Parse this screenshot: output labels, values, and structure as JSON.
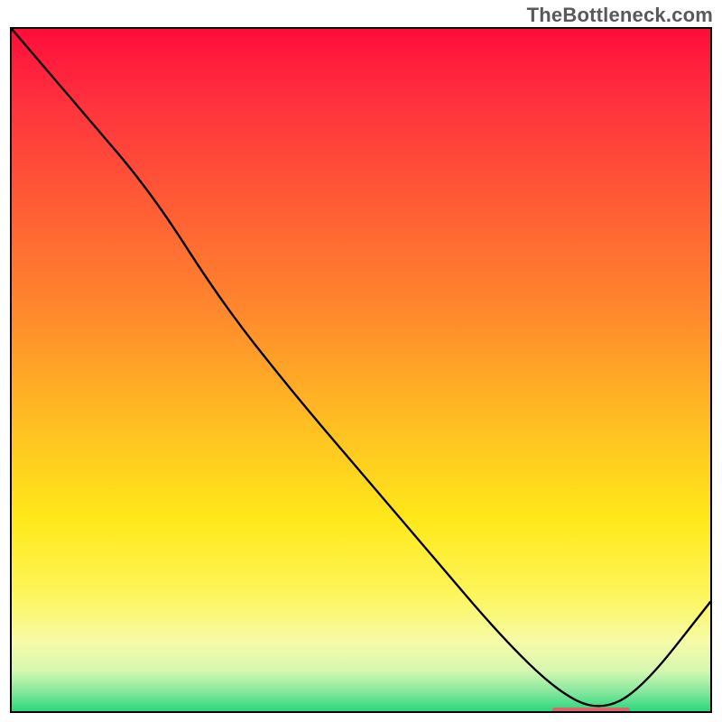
{
  "brand": "TheBottleneck.com",
  "chart_data": {
    "type": "line",
    "title": "",
    "xlabel": "",
    "ylabel": "",
    "xlim": [
      0,
      100
    ],
    "ylim": [
      0,
      100
    ],
    "grid": false,
    "series": [
      {
        "name": "curve",
        "x": [
          0,
          10,
          20,
          30,
          40,
          50,
          60,
          70,
          78,
          84,
          90,
          100
        ],
        "y": [
          100,
          88,
          76,
          60,
          47,
          35,
          23,
          11,
          3,
          0,
          3,
          16
        ]
      }
    ],
    "marker": {
      "name": "highlight-segment",
      "x_start": 77,
      "x_end": 88,
      "y": 0.6,
      "color": "#d9646a"
    },
    "background_gradient": {
      "direction": "vertical",
      "stops": [
        {
          "pos": 0.0,
          "color": "#ff0d3a"
        },
        {
          "pos": 0.25,
          "color": "#ff5a36"
        },
        {
          "pos": 0.58,
          "color": "#ffbf22"
        },
        {
          "pos": 0.83,
          "color": "#fdf65c"
        },
        {
          "pos": 0.97,
          "color": "#8ae89e"
        },
        {
          "pos": 1.0,
          "color": "#2bd87e"
        }
      ]
    }
  }
}
